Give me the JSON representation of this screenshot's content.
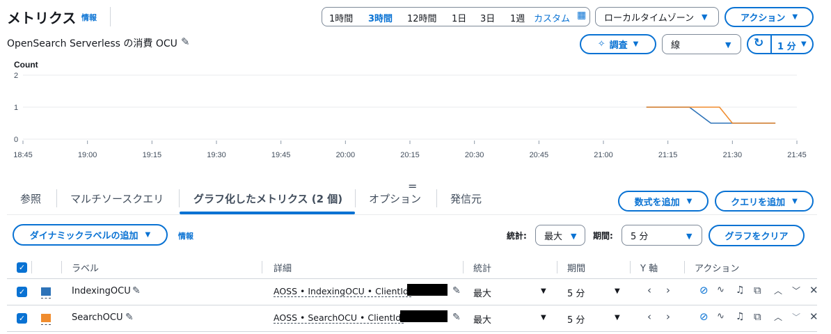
{
  "header": {
    "title": "メトリクス",
    "info": "情報",
    "graph_title": "OpenSearch Serverless の消費 OCU"
  },
  "time_range": {
    "options": [
      "1時間",
      "3時間",
      "12時間",
      "1日",
      "3日",
      "1週"
    ],
    "selected": "3時間",
    "custom": "カスタム"
  },
  "timezone": {
    "value": "ローカルタイムゾーン"
  },
  "actions_button": "アクション",
  "investigate_button": "調査",
  "chart_type_select": "線",
  "refresh_interval": "1 分",
  "chart_data": {
    "type": "line",
    "ylabel": "Count",
    "ylim": [
      0,
      2
    ],
    "yticks": [
      "0",
      "1",
      "2"
    ],
    "xticks": [
      "18:45",
      "19:00",
      "19:15",
      "19:30",
      "19:45",
      "20:00",
      "20:15",
      "20:30",
      "20:45",
      "21:00",
      "21:15",
      "21:30",
      "21:45"
    ],
    "grid": true,
    "series": [
      {
        "name": "IndexingOCU",
        "color": "#2e73b8",
        "x": [
          "21:10",
          "21:20",
          "21:25",
          "21:30",
          "21:40"
        ],
        "values": [
          1,
          1,
          0.5,
          0.5,
          0.5
        ]
      },
      {
        "name": "SearchOCU",
        "color": "#f08c2e",
        "x": [
          "21:10",
          "21:22",
          "21:27",
          "21:30",
          "21:40"
        ],
        "values": [
          1,
          1,
          1,
          0.5,
          0.5
        ]
      }
    ]
  },
  "tabs": [
    "参照",
    "マルチソースクエリ",
    "グラフ化したメトリクス (2 個)",
    "オプション",
    "発信元"
  ],
  "active_tab": "グラフ化したメトリクス (2 個)",
  "add_math_button": "数式を追加",
  "add_query_button": "クエリを追加",
  "dynamic_label_button": "ダイナミックラベルの追加",
  "toolbar_info": "情報",
  "stat_label": "統計:",
  "stat_value": "最大",
  "period_label": "期間:",
  "period_value": "5 分",
  "clear_graph_button": "グラフをクリア",
  "table": {
    "headers": [
      "ラベル",
      "詳細",
      "統計",
      "期間",
      "Y 軸",
      "アクション"
    ],
    "rows": [
      {
        "label": "IndexingOCU",
        "detail": "AOSS • IndexingOCU • ClientId:",
        "stat": "最大",
        "period": "5 分",
        "color": "#2e73b8"
      },
      {
        "label": "SearchOCU",
        "detail": "AOSS • SearchOCU • ClientId:",
        "stat": "最大",
        "period": "5 分",
        "color": "#f08c2e"
      }
    ]
  }
}
